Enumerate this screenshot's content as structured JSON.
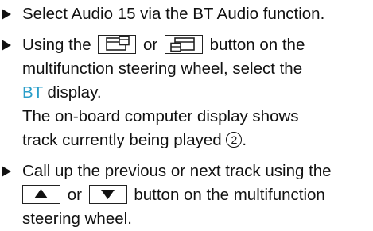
{
  "steps": [
    {
      "text": "Select Audio 15 via the BT Audio function."
    },
    {
      "line1_a": "Using the",
      "line1_b": "or",
      "line1_c": "button on the",
      "line2": "multifunction steering wheel, select the",
      "line3_highlight": "BT",
      "line3_rest": " display.",
      "line4": "The on-board computer display shows",
      "line5": "track currently being played",
      "line5_marker": "2",
      "line5_end": "."
    },
    {
      "line1": "Call up the previous or next track using the",
      "line2_b": "or",
      "line2_c": "button on the multifunction",
      "line3": "steering wheel."
    }
  ],
  "icons": {
    "page_back": "page-back-icon",
    "page_forward": "page-forward-icon",
    "up": "up-arrow-icon",
    "down": "down-arrow-icon"
  },
  "colors": {
    "highlight": "#2a9ec9",
    "text": "#111111"
  }
}
